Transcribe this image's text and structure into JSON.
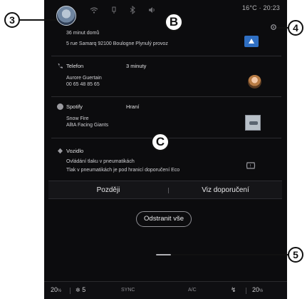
{
  "status_bar": {
    "temperature_time": "16°C · 20:23"
  },
  "notifications": [
    {
      "title": "",
      "subtitle": "",
      "lines": [
        "36 minut domů",
        "5 rue Samarq      92100 Boulogne     Plynulý provoz"
      ]
    },
    {
      "title": "Telefon",
      "subtitle": "3 minuty",
      "lines": [
        "Aurore Guertain",
        "00 65 48 85 65"
      ]
    },
    {
      "title": "Spotify",
      "subtitle": "Hraní",
      "lines": [
        "Snow Fire",
        "AlltA   Facing Giants"
      ]
    },
    {
      "title": "Vozidlo",
      "subtitle": "",
      "lines": [
        "Ovládání tlaku v pneumatikách",
        "Tlak v pneumatikách je pod hranicí doporučení Eco"
      ]
    }
  ],
  "actions": {
    "later": "Později",
    "see_recommendation": "Viz doporučení",
    "clear_all": "Odstranit vše"
  },
  "climate": {
    "left_temp": "20",
    "left_temp_unit": "½",
    "fan_level": "5",
    "sync": "SYNC",
    "ac": "A/C",
    "right_temp": "20",
    "right_temp_unit": "½"
  },
  "callouts": {
    "c3": "3",
    "c4": "4",
    "c5": "5",
    "mB": "B",
    "mC": "C"
  }
}
